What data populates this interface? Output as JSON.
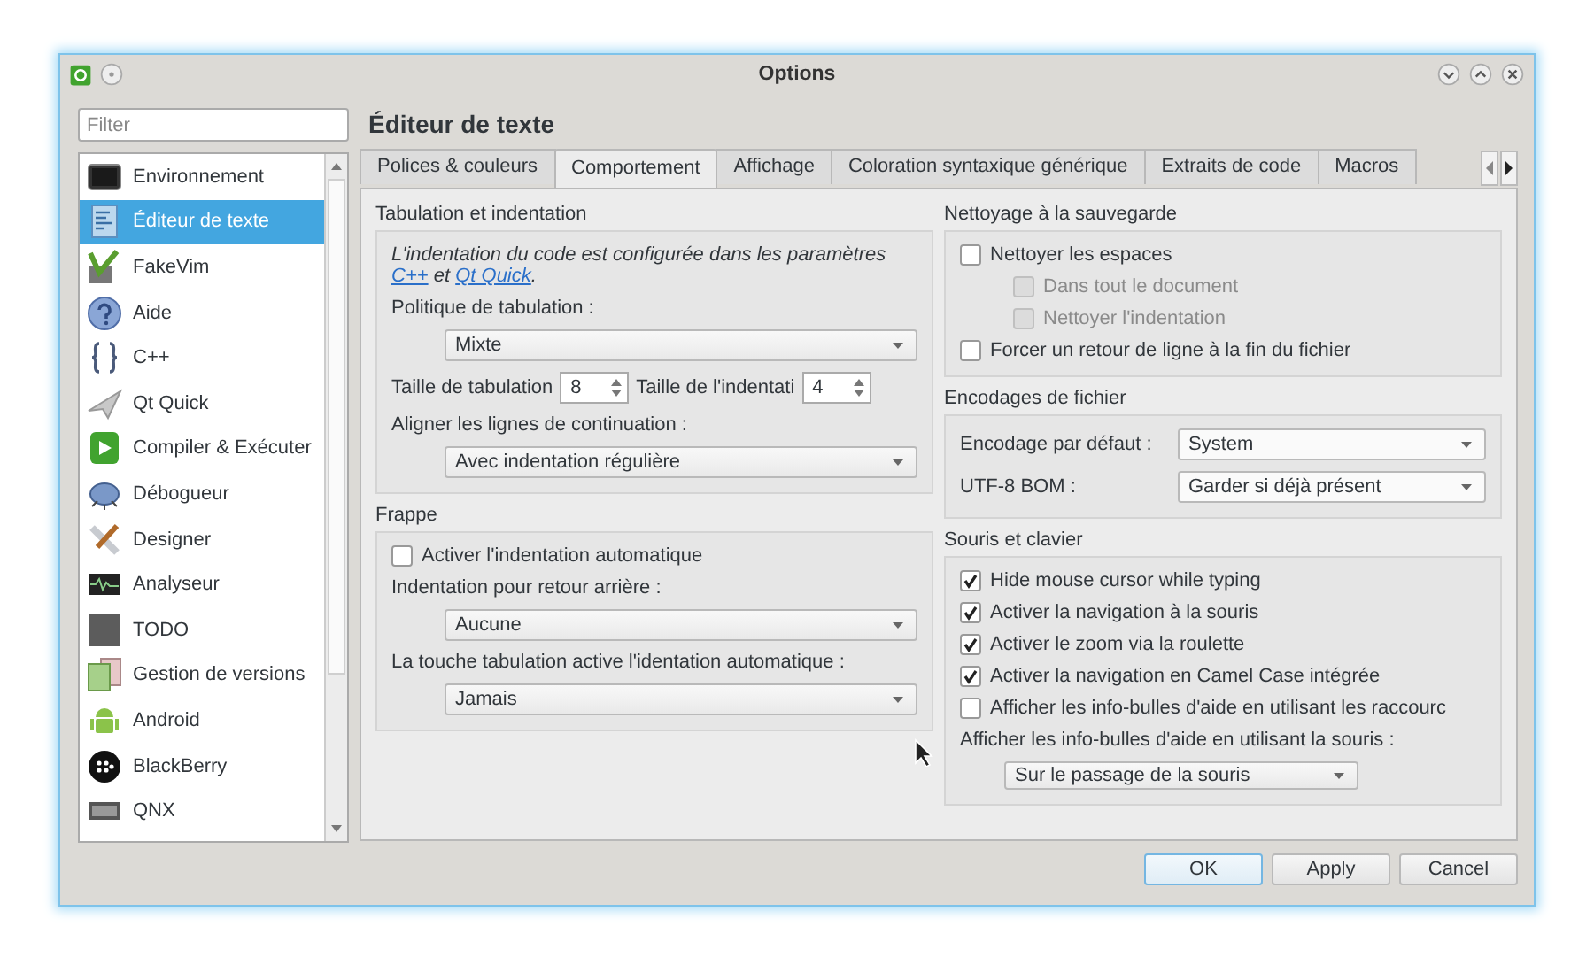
{
  "window": {
    "title": "Options"
  },
  "filter": {
    "placeholder": "Filter"
  },
  "sidebar": {
    "items": [
      {
        "label": "Environnement",
        "selected": false
      },
      {
        "label": "Éditeur de texte",
        "selected": true
      },
      {
        "label": "FakeVim",
        "selected": false
      },
      {
        "label": "Aide",
        "selected": false
      },
      {
        "label": "C++",
        "selected": false
      },
      {
        "label": "Qt Quick",
        "selected": false
      },
      {
        "label": "Compiler & Exécuter",
        "selected": false
      },
      {
        "label": "Débogueur",
        "selected": false
      },
      {
        "label": "Designer",
        "selected": false
      },
      {
        "label": "Analyseur",
        "selected": false
      },
      {
        "label": "TODO",
        "selected": false
      },
      {
        "label": "Gestion de versions",
        "selected": false
      },
      {
        "label": "Android",
        "selected": false
      },
      {
        "label": "BlackBerry",
        "selected": false
      },
      {
        "label": "QNX",
        "selected": false
      }
    ]
  },
  "page_title": "Éditeur de texte",
  "tabs": [
    {
      "label": "Polices & couleurs",
      "selected": false
    },
    {
      "label": "Comportement",
      "selected": true
    },
    {
      "label": "Affichage",
      "selected": false
    },
    {
      "label": "Coloration syntaxique générique",
      "selected": false
    },
    {
      "label": "Extraits de code",
      "selected": false
    },
    {
      "label": "Macros",
      "selected": false
    }
  ],
  "columns": [
    {
      "groups": [
        {
          "title": "Tabulation et indentation",
          "items": [
            {
              "kind": "note",
              "parts": [
                {
                  "kind": "text",
                  "text": "L'indentation du code est configurée dans les paramètres "
                },
                {
                  "kind": "link",
                  "text": "C++"
                },
                {
                  "kind": "text",
                  "text": " et "
                },
                {
                  "kind": "link",
                  "text": "Qt Quick"
                },
                {
                  "kind": "text",
                  "text": "."
                }
              ]
            },
            {
              "kind": "label",
              "text": "Politique de tabulation :"
            },
            {
              "kind": "combo",
              "value": "Mixte"
            },
            {
              "kind": "spins",
              "fields": [
                {
                  "label": "Taille de tabulation",
                  "value": "8"
                },
                {
                  "label": "Taille de l'indentati",
                  "value": "4"
                }
              ]
            },
            {
              "kind": "label",
              "text": "Aligner les lignes de continuation :"
            },
            {
              "kind": "combo",
              "value": "Avec indentation régulière"
            }
          ]
        },
        {
          "title": "Frappe",
          "items": [
            {
              "kind": "checkbox",
              "label": "Activer l'indentation automatique",
              "checked": false,
              "disabled": false
            },
            {
              "kind": "label",
              "text": "Indentation pour retour arrière :"
            },
            {
              "kind": "combo",
              "value": "Aucune"
            },
            {
              "kind": "label",
              "text": "La touche tabulation active l'identation automatique :"
            },
            {
              "kind": "combo",
              "value": "Jamais"
            }
          ]
        }
      ]
    },
    {
      "groups": [
        {
          "title": "Nettoyage à la sauvegarde",
          "items": [
            {
              "kind": "checkbox",
              "label": "Nettoyer les espaces",
              "checked": false,
              "disabled": false,
              "children": [
                {
                  "kind": "checkbox",
                  "label": "Dans tout le document",
                  "checked": false,
                  "disabled": true
                },
                {
                  "kind": "checkbox",
                  "label": "Nettoyer l'indentation",
                  "checked": false,
                  "disabled": true
                }
              ]
            },
            {
              "kind": "checkbox",
              "label": "Forcer un retour de ligne à la fin du fichier",
              "checked": false,
              "disabled": false
            }
          ]
        },
        {
          "title": "Encodages de fichier",
          "items": [
            {
              "kind": "combo_row",
              "label": "Encodage par défaut :",
              "value": "System"
            },
            {
              "kind": "combo_row",
              "label": "UTF-8 BOM :",
              "value": "Garder si déjà présent"
            }
          ]
        },
        {
          "title": "Souris et clavier",
          "items": [
            {
              "kind": "checkbox",
              "label": "Hide mouse cursor while typing",
              "checked": true,
              "disabled": false
            },
            {
              "kind": "checkbox",
              "label": "Activer la navigation à la souris",
              "checked": true,
              "disabled": false
            },
            {
              "kind": "checkbox",
              "label": "Activer le zoom via la roulette",
              "checked": true,
              "disabled": false
            },
            {
              "kind": "checkbox",
              "label": "Activer la navigation en Camel Case intégrée",
              "checked": true,
              "disabled": false
            },
            {
              "kind": "checkbox",
              "label": "Afficher les info-bulles d'aide en utilisant les raccourc",
              "checked": false,
              "disabled": false
            },
            {
              "kind": "label",
              "text": "Afficher les info-bulles d'aide en utilisant la souris :"
            },
            {
              "kind": "compact_combo",
              "value": "Sur le passage de la souris"
            }
          ]
        }
      ]
    }
  ],
  "buttons": [
    {
      "label": "OK",
      "default": true
    },
    {
      "label": "Apply",
      "default": false
    },
    {
      "label": "Cancel",
      "default": false
    }
  ]
}
